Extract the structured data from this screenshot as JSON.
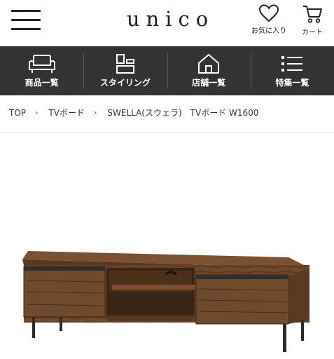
{
  "header": {
    "logo": "unico",
    "favorites_label": "お気に入り",
    "cart_label": "カート"
  },
  "nav": [
    {
      "label": "商品一覧",
      "icon": "sofa-icon"
    },
    {
      "label": "スタイリング",
      "icon": "styling-icon"
    },
    {
      "label": "店舗一覧",
      "icon": "store-icon"
    },
    {
      "label": "特集一覧",
      "icon": "list-icon"
    }
  ],
  "breadcrumb": {
    "items": [
      "TOP",
      "TVボード",
      "SWELLA(スウェラ)　TVボード W1600"
    ],
    "separator": "›"
  },
  "colors": {
    "nav_background": "#333333",
    "nav_text": "#ffffff",
    "wood": "#6b4528",
    "legs": "#2b2b2b"
  }
}
